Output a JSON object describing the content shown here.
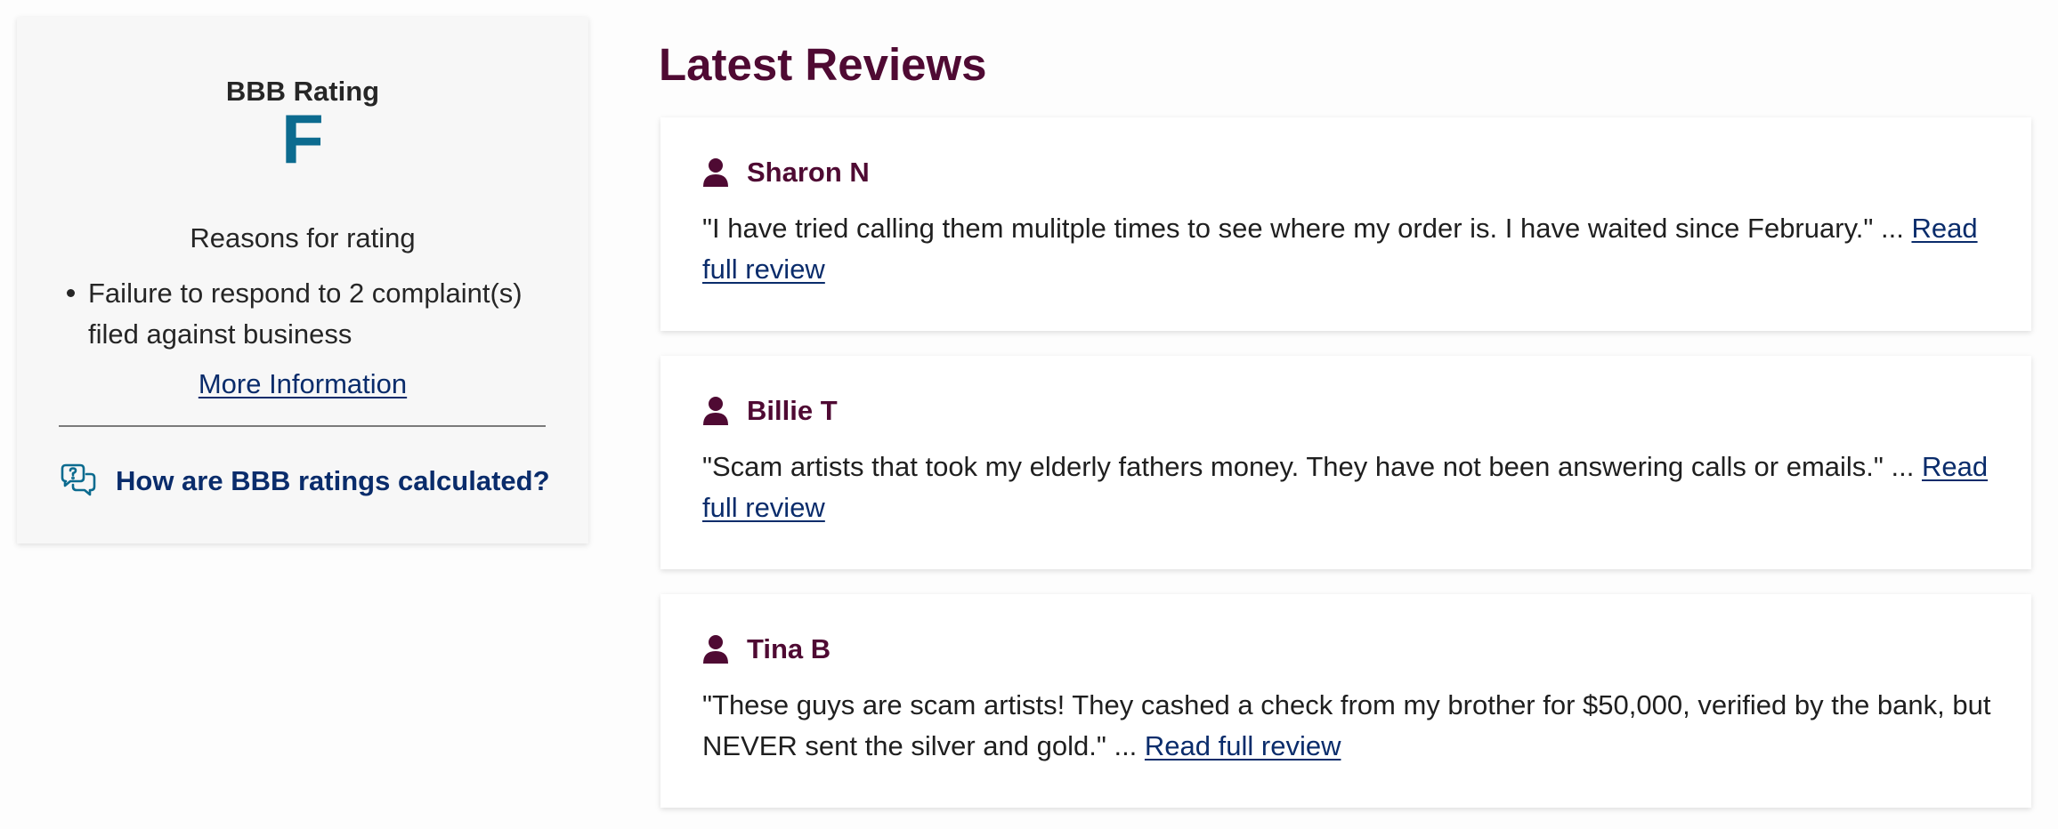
{
  "rating_card": {
    "heading": "BBB Rating",
    "grade": "F",
    "grade_color": "#0c6b8f",
    "reasons_heading": "Reasons for rating",
    "reasons": [
      "Failure to respond to 2 complaint(s) filed against business"
    ],
    "more_info_label": "More Information",
    "calc_link_label": "How are BBB ratings calculated?",
    "calc_icon": "chat-bubbles-question-icon"
  },
  "reviews": {
    "title": "Latest Reviews",
    "read_more_label": "Read full review",
    "items": [
      {
        "name": "Sharon N",
        "text": "\"I have tried calling them mulitple times to see where my order is. I have waited since February.\" ..."
      },
      {
        "name": "Billie T",
        "text": "\"Scam artists that took my elderly fathers money. They have not been answering calls or emails.\" ..."
      },
      {
        "name": "Tina B",
        "text": "\"These guys are scam artists! They cashed a check from my brother for $50,000, verified by the bank, but NEVER sent the silver and gold.\" ..."
      }
    ]
  },
  "colors": {
    "brand_maroon": "#4f0a33",
    "link_navy": "#0a2c6b",
    "grade_teal": "#0c6b8f"
  }
}
